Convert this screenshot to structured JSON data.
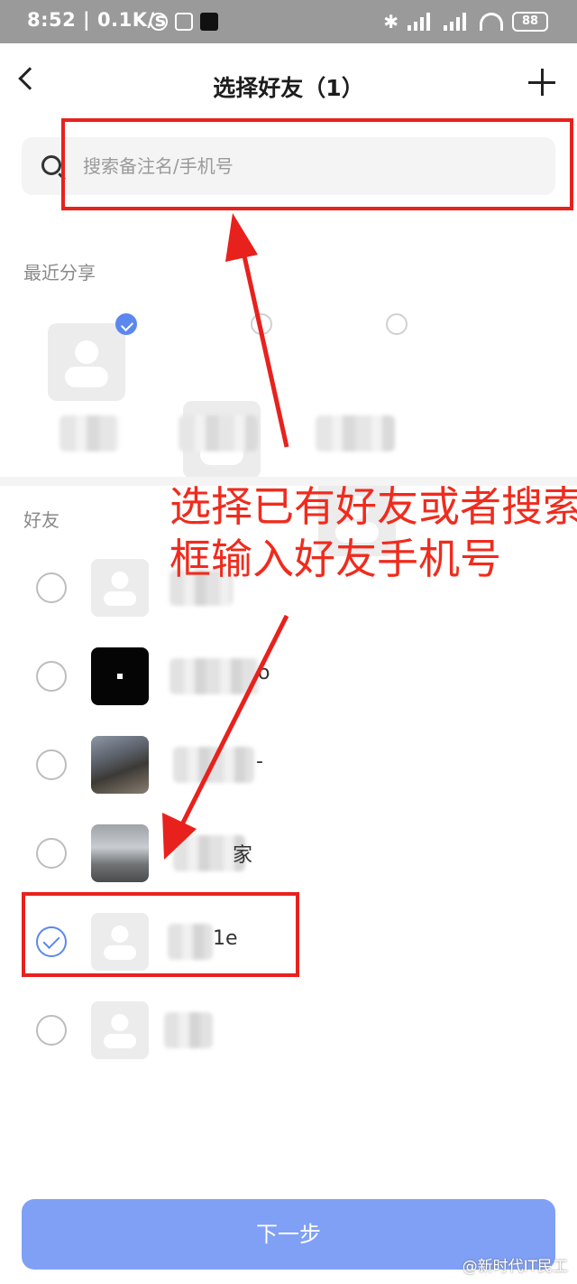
{
  "status_bar": {
    "time": "8:52",
    "speed": "0.1K/s",
    "battery": "88",
    "bluetooth_icon": "bluetooth-icon",
    "signal_icon": "cellular-signal-icon",
    "wifi_icon": "wifi-icon",
    "notification_icons": [
      "alarm-icon",
      "nfc-icon",
      "tiktok-icon"
    ]
  },
  "header": {
    "title": "选择好友（1）",
    "back_icon": "back-icon",
    "add_icon": "plus-icon"
  },
  "search": {
    "placeholder": "搜索备注名/手机号",
    "icon": "search-icon"
  },
  "recent": {
    "label": "最近分享",
    "items": [
      {
        "selected": true
      },
      {
        "selected": false
      },
      {
        "selected": false
      }
    ]
  },
  "friends": {
    "label": "好友",
    "items": [
      {
        "selected": false,
        "avatar": "default",
        "name_visible": ""
      },
      {
        "selected": false,
        "avatar": "black",
        "name_visible": "o"
      },
      {
        "selected": false,
        "avatar": "photo",
        "name_visible": "-"
      },
      {
        "selected": false,
        "avatar": "photo",
        "name_visible": "家"
      },
      {
        "selected": true,
        "avatar": "default",
        "name_visible": "1e"
      },
      {
        "selected": false,
        "avatar": "default",
        "name_visible": ""
      }
    ]
  },
  "annotation": {
    "text_line1": "选择已有好友或者搜索",
    "text_line2": "框输入好友手机号",
    "color": "#f02b1d"
  },
  "footer": {
    "next_label": "下一步"
  },
  "watermark": "@新时代IT民工",
  "colors": {
    "accent": "#5b87ef",
    "button": "#7fa0f5",
    "annotation_red": "#e8211d"
  }
}
